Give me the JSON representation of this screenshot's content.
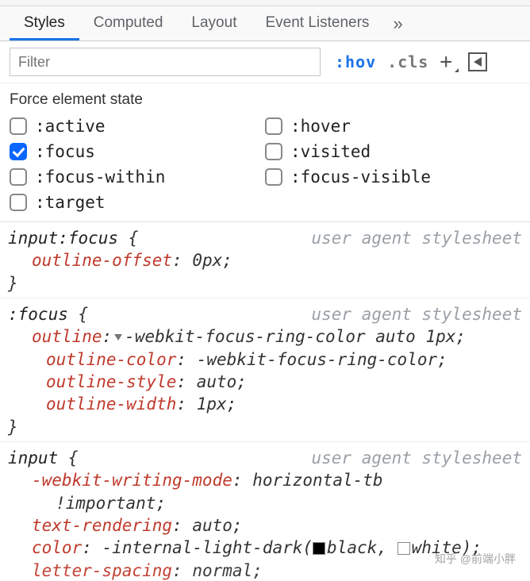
{
  "tabs": {
    "items": [
      "Styles",
      "Computed",
      "Layout",
      "Event Listeners"
    ],
    "activeIndex": 0,
    "overflow": "»"
  },
  "toolbar": {
    "filterPlaceholder": "Filter",
    "hov": ":hov",
    "cls": ".cls",
    "plus": "+"
  },
  "force": {
    "title": "Force element state",
    "states": [
      {
        "label": ":active",
        "checked": false
      },
      {
        "label": ":hover",
        "checked": false
      },
      {
        "label": ":focus",
        "checked": true
      },
      {
        "label": ":visited",
        "checked": false
      },
      {
        "label": ":focus-within",
        "checked": false
      },
      {
        "label": ":focus-visible",
        "checked": false
      },
      {
        "label": ":target",
        "checked": false
      }
    ]
  },
  "rules": [
    {
      "selector": "input:focus",
      "source": "user agent stylesheet",
      "decls": [
        {
          "prop": "outline-offset",
          "val": "0px"
        }
      ]
    },
    {
      "selector": ":focus",
      "source": "user agent stylesheet",
      "decls": [
        {
          "prop": "outline",
          "val": "-webkit-focus-ring-color auto 1px",
          "expandable": true,
          "sub": [
            {
              "prop": "outline-color",
              "val": "-webkit-focus-ring-color"
            },
            {
              "prop": "outline-style",
              "val": "auto"
            },
            {
              "prop": "outline-width",
              "val": "1px"
            }
          ]
        }
      ]
    },
    {
      "selector": "input",
      "source": "user agent stylesheet",
      "decls": [
        {
          "prop": "-webkit-writing-mode",
          "val": "horizontal-tb",
          "important": true
        },
        {
          "prop": "text-rendering",
          "val": "auto"
        },
        {
          "prop": "color",
          "val_pre": "-internal-light-dark(",
          "swatches": [
            {
              "color": "black",
              "txt": "black"
            },
            {
              "color": "white",
              "txt": "white"
            }
          ],
          "val_post": ")"
        },
        {
          "prop": "letter-spacing",
          "val": "normal",
          "cutoff": true
        }
      ]
    }
  ],
  "watermark": "知乎 @前端小胖"
}
